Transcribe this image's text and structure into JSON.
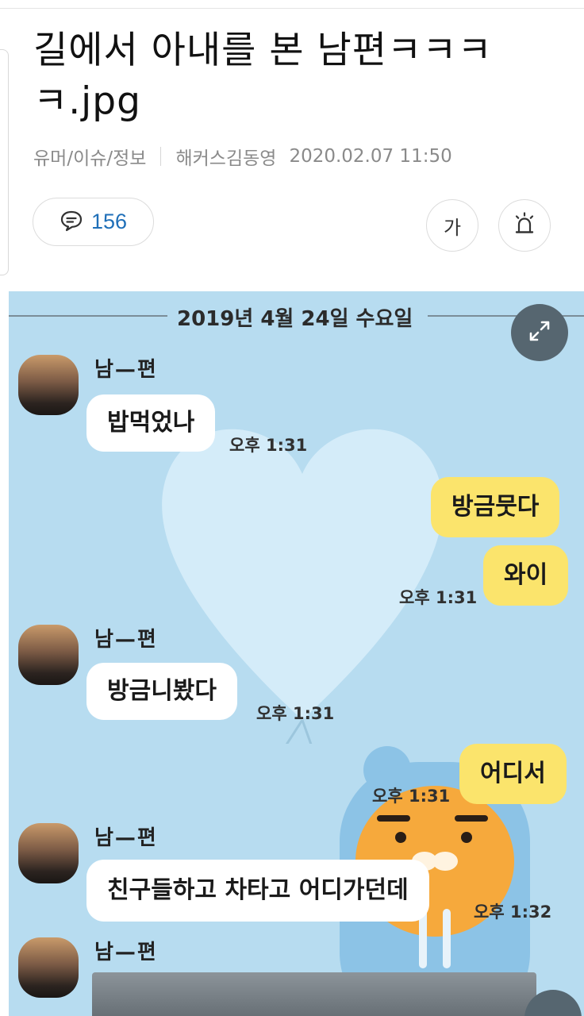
{
  "post": {
    "title": "길에서 아내를 본 남편ㅋㅋㅋㅋ.jpg",
    "category": "유머/이슈/정보",
    "author": "해커스김동영",
    "date": "2020.02.07 11:50",
    "comment_count": "156",
    "font_size_label": "가"
  },
  "chat": {
    "date_divider": "2019년 4월 24일 수요일",
    "messages": [
      {
        "sender": "남—편",
        "text": "밥먹었나",
        "time": "오후 1:31"
      },
      {
        "text": "방금뭇다"
      },
      {
        "text": "와이",
        "time": "오후 1:31"
      },
      {
        "sender": "남—편",
        "text": "방금니봤다",
        "time": "오후 1:31"
      },
      {
        "text": "어디서",
        "time": "오후 1:31"
      },
      {
        "sender": "남—편",
        "text": "친구들하고 차타고 어디가던데",
        "time": "오후 1:32"
      },
      {
        "sender": "남—편"
      }
    ]
  },
  "colors": {
    "chat_bg": "#b7dcf0",
    "my_bubble": "#fbe46c",
    "comment_count": "#1f6fb8"
  },
  "icons": [
    "comment-icon",
    "font-size-icon",
    "siren-icon",
    "expand-icon"
  ]
}
